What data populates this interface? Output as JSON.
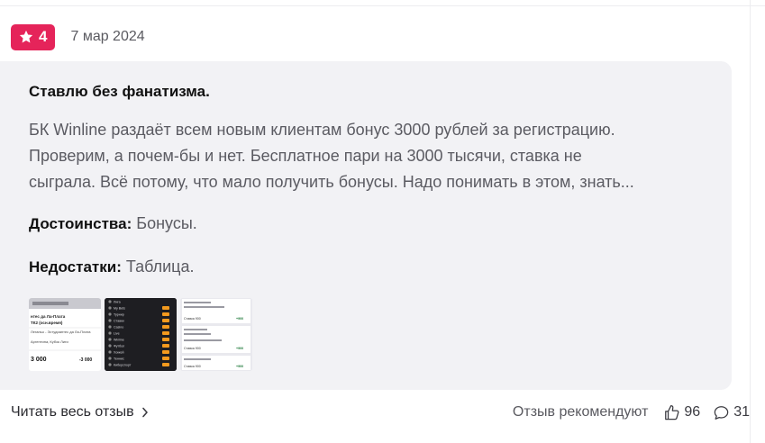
{
  "header": {
    "rating": "4",
    "date": "7 мар 2024"
  },
  "review": {
    "title": "Ставлю без фанатизма.",
    "body_lines": [
      "БК Winline раздаёт всем новым клиентам бонус 3000 рублей за регистрацию.",
      "Проверим, а почем-бы и нет. Бесплатное пари на 3000 тысячи, ставка не",
      "сыграла. Всё потому, что мало получить бонусы. Надо понимать в этом, знать..."
    ],
    "pros_label": "Достоинства:",
    "pros_value": "Бонусы.",
    "cons_label": "Недостатки:",
    "cons_value": "Таблица."
  },
  "thumbnails": {
    "thumb1": {
      "lines": [
        "нтес да Ла-Плата",
        "ТК2 (осн.время)",
        "Леганьо - Эстудиантес да Ла-Плата",
        "Аргентина, Кубок Лиги",
        "3 000",
        "-3 000"
      ]
    },
    "thumb2": {
      "items": [
        "Лига",
        "My Bets",
        "Турнир",
        "Ставки",
        "Casino",
        "Live",
        "Winline",
        "Футбол",
        "Хоккей",
        "Теннис",
        "Киберспорт"
      ]
    },
    "thumb3": {
      "lines": [
        "Ставка 900",
        "Ставка 900",
        "Ставка 900",
        "+900",
        "+900",
        "+900"
      ]
    }
  },
  "footer": {
    "read_more": "Читать весь отзыв",
    "recommend_label": "Отзыв рекомендуют",
    "likes": "96",
    "comments": "31"
  },
  "colors": {
    "accent": "#e5245a",
    "panel": "#f2f2f5",
    "text_muted": "#5b5b62"
  }
}
